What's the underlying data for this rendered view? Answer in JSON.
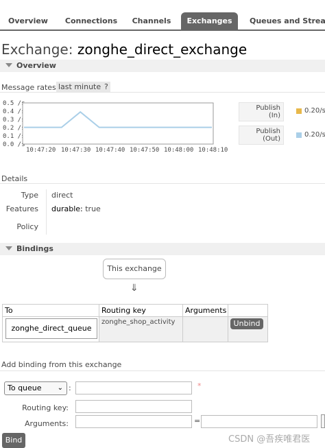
{
  "nav": {
    "tabs": [
      {
        "label": "Overview",
        "active": false
      },
      {
        "label": "Connections",
        "active": false
      },
      {
        "label": "Channels",
        "active": false
      },
      {
        "label": "Exchanges",
        "active": true
      },
      {
        "label": "Queues and Streams",
        "active": false
      }
    ]
  },
  "title": {
    "prefix": "Exchange: ",
    "name": "zonghe_direct_exchange"
  },
  "overview": {
    "section_label": "Overview",
    "message_rates_label": "Message rates",
    "range_label": "last minute",
    "help_label": "?"
  },
  "chart_data": {
    "type": "line",
    "x": [
      "10:47:20",
      "10:47:25",
      "10:47:30",
      "10:47:35",
      "10:47:40",
      "10:47:45",
      "10:47:50",
      "10:47:55",
      "10:48:00",
      "10:48:05",
      "10:48:10"
    ],
    "x_tick_labels": [
      "10:47:20",
      "10:47:30",
      "10:47:40",
      "10:47:50",
      "10:48:00",
      "10:48:10"
    ],
    "y_tick_labels": [
      "0.5 /s",
      "0.4 /s",
      "0.3 /s",
      "0.2 /s",
      "0.1 /s",
      "0.0 /s"
    ],
    "ylim": [
      0,
      0.5
    ],
    "series": [
      {
        "name": "Publish (Out)",
        "color": "#aacfe8",
        "values": [
          0.2,
          0.2,
          0.2,
          0.4,
          0.2,
          0.2,
          0.2,
          0.2,
          0.2,
          0.2,
          0.2
        ]
      }
    ],
    "legend": [
      {
        "line1": "Publish",
        "line2": "(In)",
        "value": "0.20/s",
        "color": "#e8b84a"
      },
      {
        "line1": "Publish",
        "line2": "(Out)",
        "value": "0.20/s",
        "color": "#aacfe8"
      }
    ]
  },
  "details": {
    "heading": "Details",
    "rows": [
      {
        "label": "Type",
        "value": "direct"
      },
      {
        "label": "Features",
        "key": "durable:",
        "value": "true"
      },
      {
        "label": "Policy",
        "value": ""
      }
    ]
  },
  "bindings": {
    "section_label": "Bindings",
    "this_exchange": "This exchange",
    "arrow": "⇓",
    "columns": [
      "To",
      "Routing key",
      "Arguments"
    ],
    "rows": [
      {
        "to": "zonghe_direct_queue",
        "routing_key": "zonghe_shop_activity",
        "arguments": "",
        "action": "Unbind"
      }
    ]
  },
  "add_binding": {
    "heading": "Add binding from this exchange",
    "destination_type": "To queue",
    "colon": ":",
    "required_mark": "*",
    "routing_key_label": "Routing key:",
    "arguments_label": "Arguments:",
    "equals": "=",
    "submit_label": "Bind"
  },
  "watermark": "CSDN @吾疾唯君医"
}
